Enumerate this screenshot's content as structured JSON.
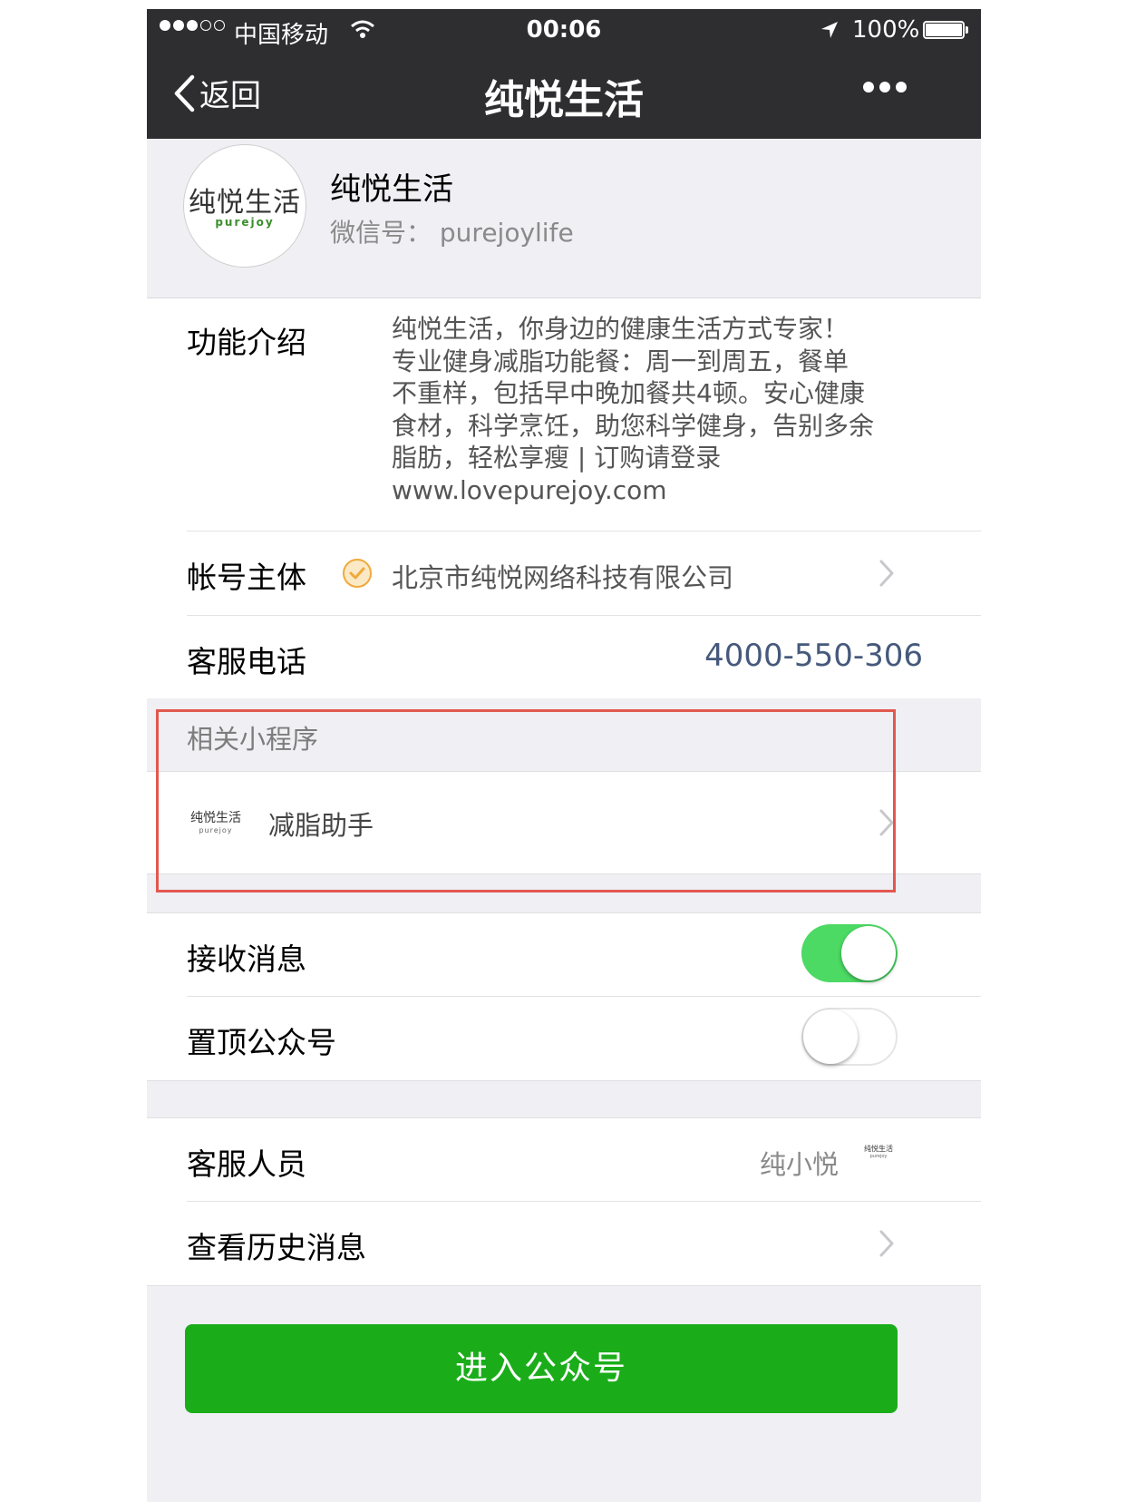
{
  "status_bar": {
    "carrier": "中国移动",
    "time": "00:06",
    "battery": "100%"
  },
  "nav": {
    "back_label": "返回",
    "title": "纯悦生活"
  },
  "profile": {
    "avatar_cn": "纯悦生活",
    "avatar_en": "purejoy",
    "name": "纯悦生活",
    "wechat_id": "微信号： purejoylife"
  },
  "intro": {
    "label": "功能介绍",
    "lines": [
      "纯悦生活，你身边的健康生活方式专家！",
      "专业健身减脂功能餐：周一到周五，餐单",
      "不重样，包括早中晚加餐共4顿。安心健康",
      "食材，科学烹饪，助您科学健身，告别多余",
      "脂肪，轻松享瘦 | 订购请登录",
      "www.lovepurejoy.com"
    ]
  },
  "account": {
    "label": "帐号主体",
    "value": "北京市纯悦网络科技有限公司"
  },
  "service_phone": {
    "label": "客服电话",
    "value": "4000-550-306"
  },
  "mini_programs": {
    "header": "相关小程序",
    "logo_cn": "纯悦生活",
    "logo_en": "purejoy",
    "item": "减脂助手"
  },
  "settings": {
    "receive_label": "接收消息",
    "receive_on": true,
    "pin_label": "置顶公众号",
    "pin_on": false
  },
  "agent": {
    "label": "客服人员",
    "name": "纯小悦",
    "logo_cn": "纯悦生活",
    "logo_en": "purejoy"
  },
  "history": {
    "label": "查看历史消息"
  },
  "enter_button": "进入公众号",
  "colors": {
    "nav_bg": "#2e2e30",
    "toggle_on": "#4cd964",
    "primary_button": "#1aad19",
    "phone_link": "#46597c",
    "highlight_box": "#e2584f",
    "verified_badge": "#f0a93b"
  }
}
